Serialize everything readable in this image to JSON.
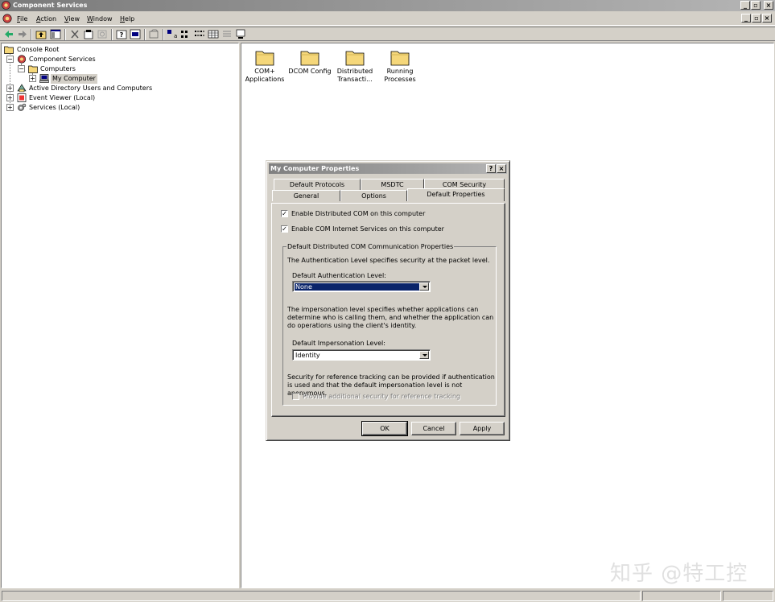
{
  "window": {
    "title": "Component Services",
    "btn_min": "_",
    "btn_max": "▫",
    "btn_close": "×"
  },
  "menu": {
    "file": "File",
    "action": "Action",
    "view": "View",
    "window": "Window",
    "help": "Help"
  },
  "tree": {
    "root": "Console Root",
    "component_services": "Component Services",
    "computers": "Computers",
    "my_computer": "My Computer",
    "active_directory": "Active Directory Users and Computers",
    "event_viewer": "Event Viewer (Local)",
    "services": "Services (Local)",
    "expand_plus": "+",
    "expand_minus": "−"
  },
  "items": [
    {
      "line1": "COM+",
      "line2": "Applications"
    },
    {
      "line1": "DCOM Config",
      "line2": ""
    },
    {
      "line1": "Distributed",
      "line2": "Transacti..."
    },
    {
      "line1": "Running",
      "line2": "Processes"
    }
  ],
  "dialog": {
    "title": "My Computer Properties",
    "help_btn": "?",
    "close_btn": "×",
    "tabs_back": [
      "Default Protocols",
      "MSDTC",
      "COM Security"
    ],
    "tabs_front": [
      "General",
      "Options",
      "Default Properties"
    ],
    "enable_dcom": "Enable Distributed COM on this computer",
    "enable_cis": "Enable COM Internet Services on this computer",
    "check_mark": "✓",
    "group_title": "Default Distributed COM Communication Properties",
    "auth_desc": "The Authentication Level specifies security at the packet level.",
    "auth_label": "Default Authentication Level:",
    "auth_value": "None",
    "imp_desc": "The impersonation level specifies whether applications can determine who is calling them, and whether the application can do operations using the client's identity.",
    "imp_label": "Default Impersonation Level:",
    "imp_value": "Identity",
    "ref_desc": "Security for reference tracking can be provided if authentication is used and that the default impersonation level is not anonymous.",
    "ref_check": "Provide additional security for reference tracking",
    "ok": "OK",
    "cancel": "Cancel",
    "apply": "Apply"
  },
  "watermark": "知乎 @特工控",
  "colors": {
    "selection": "#0a246a",
    "face": "#d4d0c8",
    "folder": "#f5d77a"
  }
}
